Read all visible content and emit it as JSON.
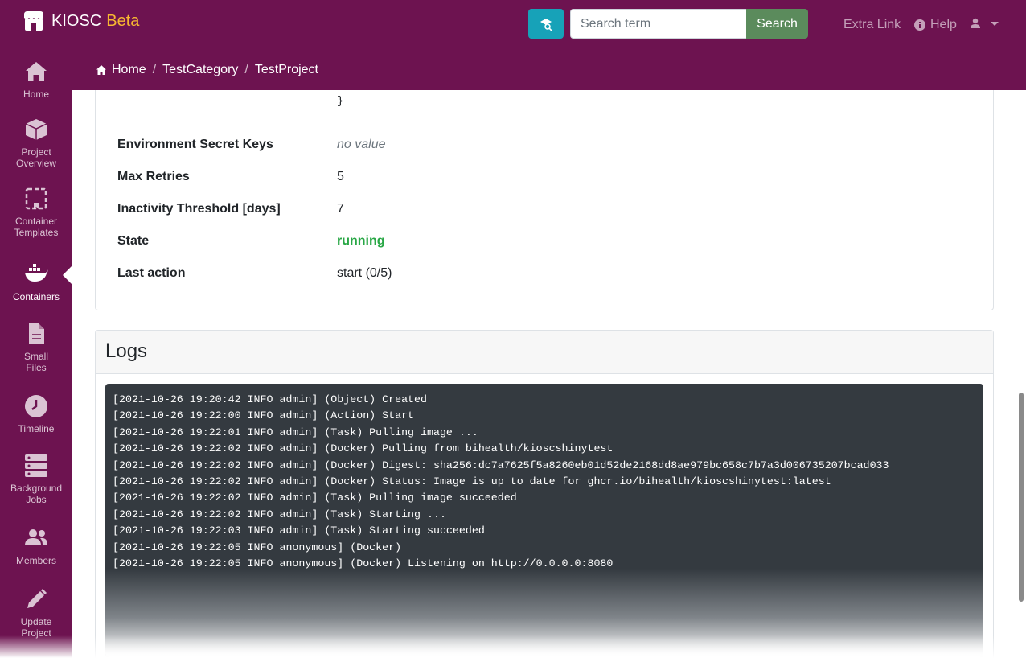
{
  "brand": {
    "name": "KIOSC",
    "badge": "Beta"
  },
  "navbar": {
    "search_placeholder": "Search term",
    "search_button": "Search",
    "extra_link": "Extra Link",
    "help": "Help"
  },
  "sidebar": {
    "items": [
      {
        "label": "Home",
        "icon": "home-icon"
      },
      {
        "label": "Project Overview",
        "icon": "cube-icon"
      },
      {
        "label": "Container Templates",
        "icon": "template-icon"
      },
      {
        "label": "Containers",
        "icon": "docker-icon"
      },
      {
        "label": "Small Files",
        "icon": "file-icon"
      },
      {
        "label": "Timeline",
        "icon": "clock-icon"
      },
      {
        "label": "Background Jobs",
        "icon": "server-icon"
      },
      {
        "label": "Members",
        "icon": "users-icon"
      },
      {
        "label": "Update Project",
        "icon": "pencil-icon"
      }
    ],
    "active": "Containers"
  },
  "breadcrumb": {
    "home": "Home",
    "category": "TestCategory",
    "project": "TestProject"
  },
  "details": {
    "brace": "}",
    "rows": [
      {
        "label": "Environment Secret Keys",
        "value": "no value"
      },
      {
        "label": "Max Retries",
        "value": "5"
      },
      {
        "label": "Inactivity Threshold [days]",
        "value": "7"
      },
      {
        "label": "State",
        "value": "running"
      },
      {
        "label": "Last action",
        "value": "start (0/5)"
      }
    ]
  },
  "logs": {
    "title": "Logs",
    "lines": [
      "[2021-10-26 19:20:42 INFO admin] (Object) Created",
      "[2021-10-26 19:22:00 INFO admin] (Action) Start",
      "[2021-10-26 19:22:01 INFO admin] (Task) Pulling image ...",
      "[2021-10-26 19:22:02 INFO admin] (Docker) Pulling from bihealth/kioscshinytest",
      "[2021-10-26 19:22:02 INFO admin] (Docker) Digest: sha256:dc7a7625f5a8260eb01d52de2168dd8ae979bc658c7b7a3d006735207bcad033",
      "[2021-10-26 19:22:02 INFO admin] (Docker) Status: Image is up to date for ghcr.io/bihealth/kioscshinytest:latest",
      "[2021-10-26 19:22:02 INFO admin] (Task) Pulling image succeeded",
      "[2021-10-26 19:22:02 INFO admin] (Task) Starting ...",
      "[2021-10-26 19:22:03 INFO admin] (Task) Starting succeeded",
      "[2021-10-26 19:22:05 INFO anonymous] (Docker)",
      "[2021-10-26 19:22:05 INFO anonymous] (Docker) Listening on http://0.0.0.0:8080"
    ]
  },
  "colors": {
    "primary": "#6d1350",
    "beta": "#f7b731",
    "running": "#28a745",
    "search_btn": "#5b8b5c",
    "search_mode": "#17a2b8"
  }
}
